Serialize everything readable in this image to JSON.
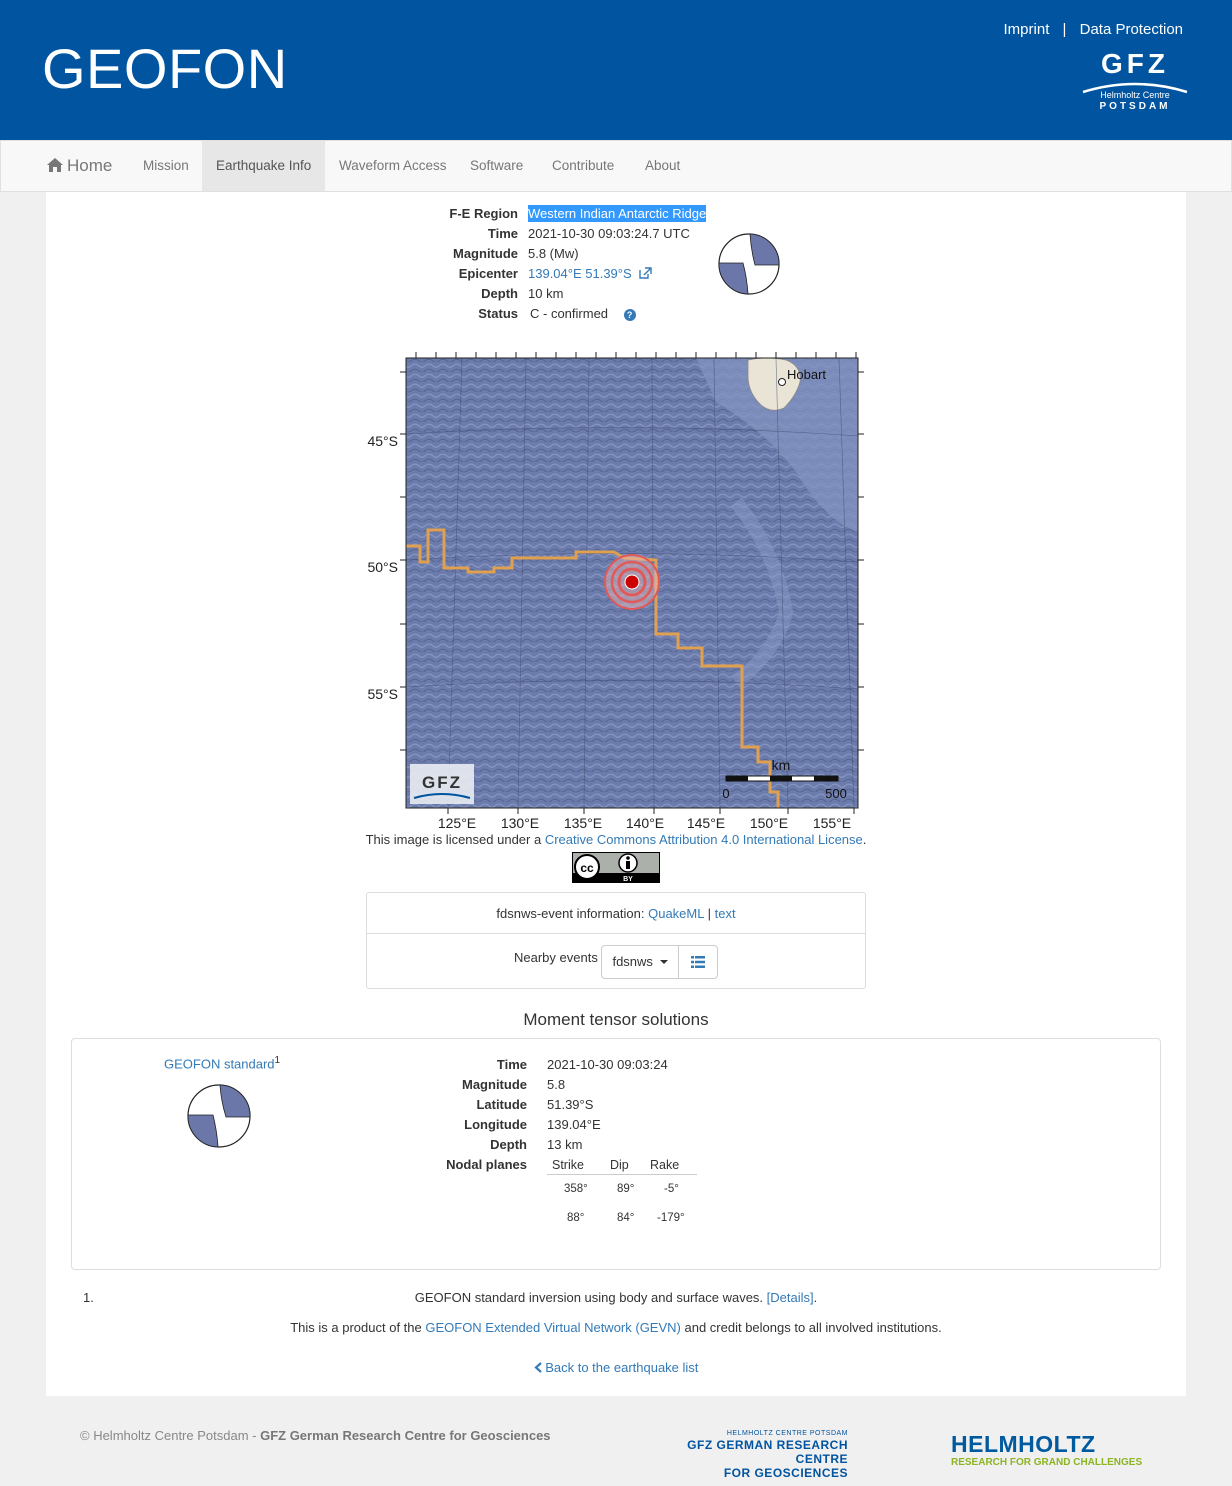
{
  "header": {
    "brand": "GEOFON",
    "links": {
      "imprint": "Imprint",
      "separator": "|",
      "data_protection": "Data Protection"
    },
    "logo": {
      "main": "GFZ",
      "line1": "Helmholtz Centre",
      "line2": "POTSDAM"
    }
  },
  "nav": {
    "home": "Home",
    "items": [
      "Mission",
      "Earthquake Info",
      "Waveform Access",
      "Software",
      "Contribute",
      "About"
    ],
    "active": "Earthquake Info"
  },
  "event": {
    "region_label": "F-E Region",
    "region": "Western Indian Antarctic Ridge",
    "time_label": "Time",
    "time": "2021-10-30 09:03:24.7 UTC",
    "magnitude_label": "Magnitude",
    "magnitude": "5.8 (Mw)",
    "epicenter_label": "Epicenter",
    "epicenter": "139.04°E 51.39°S",
    "depth_label": "Depth",
    "depth": "10 km",
    "status_label": "Status",
    "status_code": "C",
    "status": "- confirmed",
    "help_icon": "question-circle-icon"
  },
  "map": {
    "lat_labels": [
      "45°S",
      "50°S",
      "55°S"
    ],
    "lon_labels": [
      "125°E",
      "130°E",
      "135°E",
      "140°E",
      "145°E",
      "150°E",
      "155°E"
    ],
    "city": "Hobart",
    "scale_unit": "km",
    "scale_min": "0",
    "scale_max": "500",
    "watermark": "GFZ",
    "colors": {
      "ocean": "#6878a8",
      "plate_boundary": "#e0a050",
      "epicenter": "#cc0000"
    }
  },
  "license": {
    "prefix": "This image is licensed under a ",
    "link": "Creative Commons Attribution 4.0 International License",
    "suffix": ".",
    "badge_by": "BY"
  },
  "fdsn": {
    "label": "fdsnws-event information: ",
    "quakeml": "QuakeML",
    "sep": "|",
    "text": "text",
    "nearby_label": "Nearby events",
    "dropdown": "fdsnws",
    "list_icon": "list-icon"
  },
  "mt": {
    "title": "Moment tensor solutions",
    "name": "GEOFON standard",
    "footnote_ref": "1",
    "time_label": "Time",
    "time": "2021-10-30 09:03:24",
    "magnitude_label": "Magnitude",
    "magnitude": "5.8",
    "latitude_label": "Latitude",
    "latitude": "51.39°S",
    "longitude_label": "Longitude",
    "longitude": "139.04°E",
    "depth_label": "Depth",
    "depth": "13 km",
    "nodal_label": "Nodal planes",
    "np_headers": [
      "Strike",
      "Dip",
      "Rake"
    ],
    "np_rows": [
      [
        "358°",
        "89°",
        "-5°"
      ],
      [
        "88°",
        "84°",
        "-179°"
      ]
    ],
    "beachball_color": "#6a77a8"
  },
  "footnote": {
    "num": "1.",
    "text": "GEOFON standard inversion using body and surface waves. ",
    "link": "[Details]",
    "end": "."
  },
  "credit": {
    "prefix": "This is a product of the ",
    "link": "GEOFON Extended Virtual Network (GEVN)",
    "suffix": " and credit belongs to all involved institutions."
  },
  "back": "Back to the earthquake list",
  "footer": {
    "copy_prefix": "© Helmholtz Centre Potsdam - ",
    "copy_bold": "GFZ German Research Centre for Geosciences",
    "gfz_l1": "HELMHOLTZ CENTRE POTSDAM",
    "gfz_l2": "GFZ GERMAN RESEARCH CENTRE",
    "gfz_l3": "FOR GEOSCIENCES",
    "helm_l1": "HELMHOLTZ",
    "helm_l2": "RESEARCH FOR GRAND CHALLENGES"
  }
}
